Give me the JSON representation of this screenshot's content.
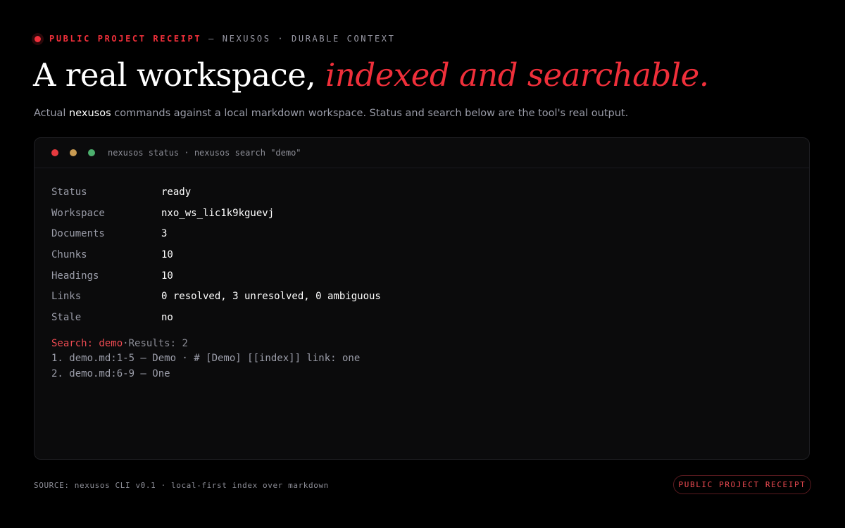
{
  "eyebrow": {
    "tag": "PUBLIC PROJECT RECEIPT",
    "rest": "— NEXUSOS · DURABLE CONTEXT"
  },
  "headline": {
    "plain": "A real workspace, ",
    "accent": "indexed and searchable."
  },
  "subtitle": {
    "prefix": "Actual ",
    "command": "nexusos",
    "suffix": " commands against a local markdown workspace. Status and search below are the tool's real output."
  },
  "terminal": {
    "title": "nexusos status · nexusos search \"demo\"",
    "status_rows": [
      {
        "key": "Status",
        "value": "ready"
      },
      {
        "key": "Workspace",
        "value": "nxo_ws_lic1k9kguevj"
      },
      {
        "key": "Documents",
        "value": "3"
      },
      {
        "key": "Chunks",
        "value": "10"
      },
      {
        "key": "Headings",
        "value": "10"
      },
      {
        "key": "Links",
        "value": "0 resolved, 3 unresolved, 0 ambiguous"
      },
      {
        "key": "Stale",
        "value": "no"
      }
    ],
    "search": {
      "label": "Search: demo",
      "separator": " · ",
      "results_text": "Results: 2",
      "results": [
        "1. demo.md:1-5 — Demo · # [Demo] [[index]] link: one",
        "2. demo.md:6-9 — One"
      ]
    }
  },
  "footer": {
    "source": "SOURCE: nexusos CLI v0.1 · local-first index over markdown",
    "badge": "PUBLIC PROJECT RECEIPT"
  },
  "colors": {
    "accent": "#ef2f3a",
    "background": "#000000",
    "terminal_bg": "#0b0b0c",
    "light_red": "#e63a3f",
    "light_yellow": "#c99b52",
    "light_green": "#4caf6d"
  }
}
